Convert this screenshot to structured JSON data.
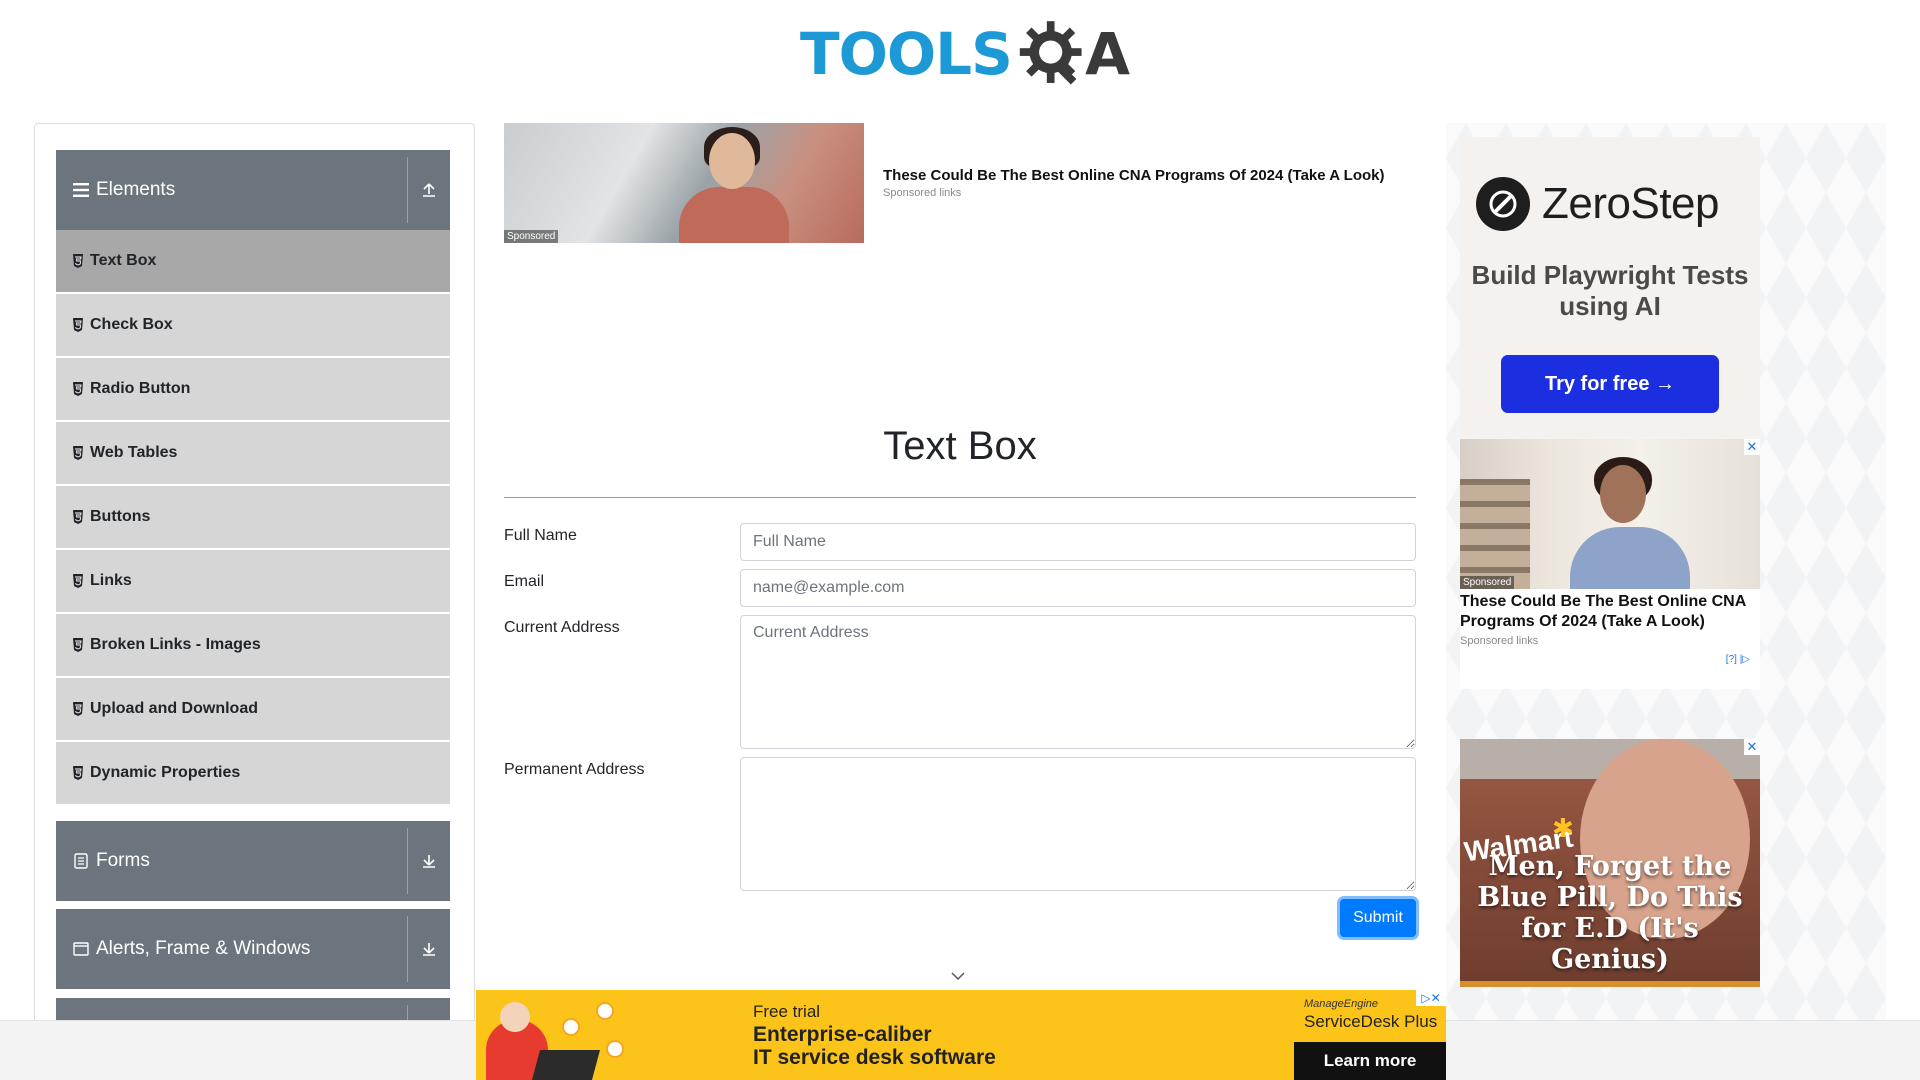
{
  "logo": {
    "text": "TOOLS",
    "suffix": "A"
  },
  "sidebar": {
    "groups": [
      {
        "label": "Elements",
        "toggle": "collapse"
      },
      {
        "label": "Forms",
        "toggle": "expand"
      },
      {
        "label": "Alerts, Frame & Windows",
        "toggle": "expand"
      }
    ],
    "items": [
      {
        "label": "Text Box",
        "active": true
      },
      {
        "label": "Check Box"
      },
      {
        "label": "Radio Button"
      },
      {
        "label": "Web Tables"
      },
      {
        "label": "Buttons"
      },
      {
        "label": "Links"
      },
      {
        "label": "Broken Links - Images"
      },
      {
        "label": "Upload and Download"
      },
      {
        "label": "Dynamic Properties"
      }
    ]
  },
  "top_ad": {
    "badge": "Sponsored",
    "title": "These Could Be The Best Online CNA Programs Of 2024 (Take A Look)",
    "sub": "Sponsored links"
  },
  "main": {
    "title": "Text Box",
    "form": {
      "full_name": {
        "label": "Full Name",
        "placeholder": "Full Name",
        "value": ""
      },
      "email": {
        "label": "Email",
        "placeholder": "name@example.com",
        "value": ""
      },
      "current_address": {
        "label": "Current Address",
        "placeholder": "Current Address",
        "value": ""
      },
      "permanent_address": {
        "label": "Permanent Address",
        "placeholder": "",
        "value": ""
      },
      "submit_label": "Submit"
    }
  },
  "right_ads": {
    "zerostep": {
      "brand": "ZeroStep",
      "tagline": "Build Playwright Tests using AI",
      "cta": "Try for free →"
    },
    "cna": {
      "badge": "Sponsored",
      "title": "These Could Be The Best Online CNA Programs Of 2024 (Take A Look)",
      "sub": "Sponsored links",
      "adchoice": "[?] |"
    },
    "walmart": {
      "logo": "Walmart",
      "headline": "Men, Forget the Blue Pill, Do This for E.D (It's Genius)"
    }
  },
  "bottom_ad": {
    "free_trial": "Free trial",
    "headline_line1": "Enterprise-caliber",
    "headline_line2": "IT service desk software",
    "brand_top": "ManageEngine",
    "brand": "ServiceDesk Plus",
    "cta": "Learn more"
  },
  "colors": {
    "brand_blue": "#1d9ad6",
    "group_header": "#6c757d",
    "menu_item": "#d6d6d6",
    "menu_active": "#a8a8a8",
    "primary": "#007bff",
    "ad_yellow": "#fcc419",
    "zerostep_cta": "#1b2fe0"
  }
}
